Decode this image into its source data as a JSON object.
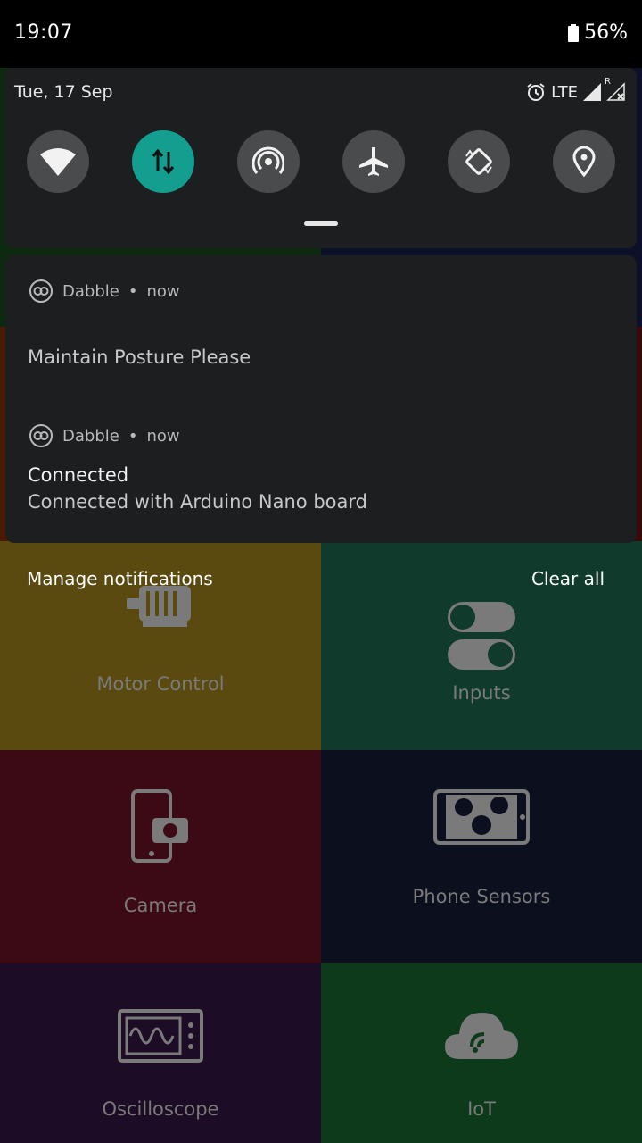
{
  "status_bar": {
    "time": "19:07",
    "battery": "56%"
  },
  "quick_settings": {
    "date": "Tue, 17 Sep",
    "network_label": "LTE",
    "roaming_label": "R",
    "tiles": [
      {
        "name": "wifi",
        "active": false
      },
      {
        "name": "mobile-data",
        "active": true
      },
      {
        "name": "hotspot",
        "active": false
      },
      {
        "name": "airplane-mode",
        "active": false
      },
      {
        "name": "auto-rotate",
        "active": false
      },
      {
        "name": "location",
        "active": false
      }
    ]
  },
  "notifications": [
    {
      "app": "Dabble",
      "time": "now",
      "title": "",
      "body": "Maintain Posture Please"
    },
    {
      "app": "Dabble",
      "time": "now",
      "title": "Connected",
      "body": "Connected with Arduino Nano board"
    }
  ],
  "actions": {
    "manage": "Manage notifications",
    "clear": "Clear all"
  },
  "app_grid": {
    "tiles": [
      {
        "label": "Motor Control",
        "color": "#5a4a10"
      },
      {
        "label": "Inputs",
        "color": "#0f3a2c"
      },
      {
        "label": "Camera",
        "color": "#3c0a14"
      },
      {
        "label": "Phone Sensors",
        "color": "#0c0f1e"
      },
      {
        "label": "Oscilloscope",
        "color": "#1c0c26"
      },
      {
        "label": "IoT",
        "color": "#0d3a1a"
      }
    ]
  }
}
